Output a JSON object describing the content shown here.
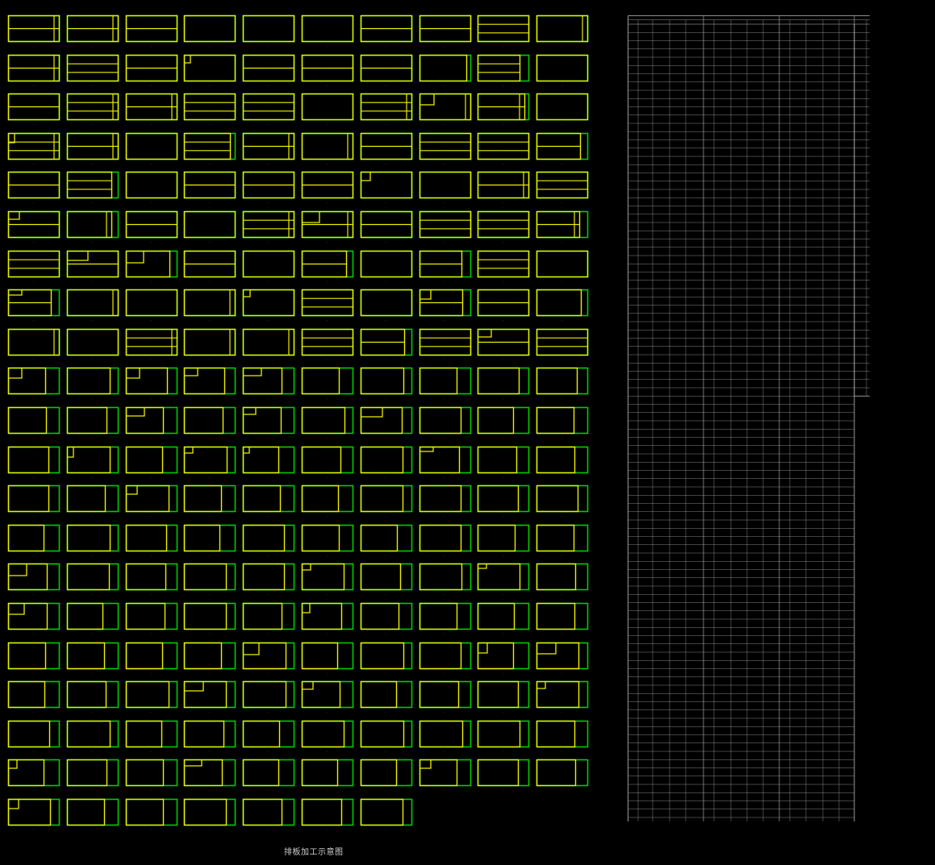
{
  "drawing": {
    "caption": "排板加工示意图",
    "colors": {
      "background": "#000000",
      "panel_outline": "#00cc00",
      "cut_line": "#eeee00",
      "table_line": "#bfbfbf",
      "label_text": "#d0d0d0"
    }
  },
  "layout_sheet": {
    "rows": [
      {
        "row": 1,
        "panels": 10
      },
      {
        "row": 2,
        "panels": 10
      },
      {
        "row": 3,
        "panels": 10
      },
      {
        "row": 4,
        "panels": 10
      },
      {
        "row": 5,
        "panels": 10
      },
      {
        "row": 6,
        "panels": 10
      },
      {
        "row": 7,
        "panels": 10
      },
      {
        "row": 8,
        "panels": 10
      },
      {
        "row": 9,
        "panels": 10
      },
      {
        "row": 10,
        "panels": 10
      },
      {
        "row": 11,
        "panels": 10
      },
      {
        "row": 12,
        "panels": 10
      },
      {
        "row": 13,
        "panels": 10
      },
      {
        "row": 14,
        "panels": 10
      },
      {
        "row": 15,
        "panels": 10
      },
      {
        "row": 16,
        "panels": 10
      },
      {
        "row": 17,
        "panels": 10
      },
      {
        "row": 18,
        "panels": 10
      },
      {
        "row": 19,
        "panels": 10
      },
      {
        "row": 20,
        "panels": 10
      },
      {
        "row": 21,
        "panels": 7
      }
    ]
  },
  "schedule": {
    "groups": [
      "—",
      "—",
      "—",
      "—"
    ],
    "rows_long": 97,
    "rows_short": 45
  }
}
